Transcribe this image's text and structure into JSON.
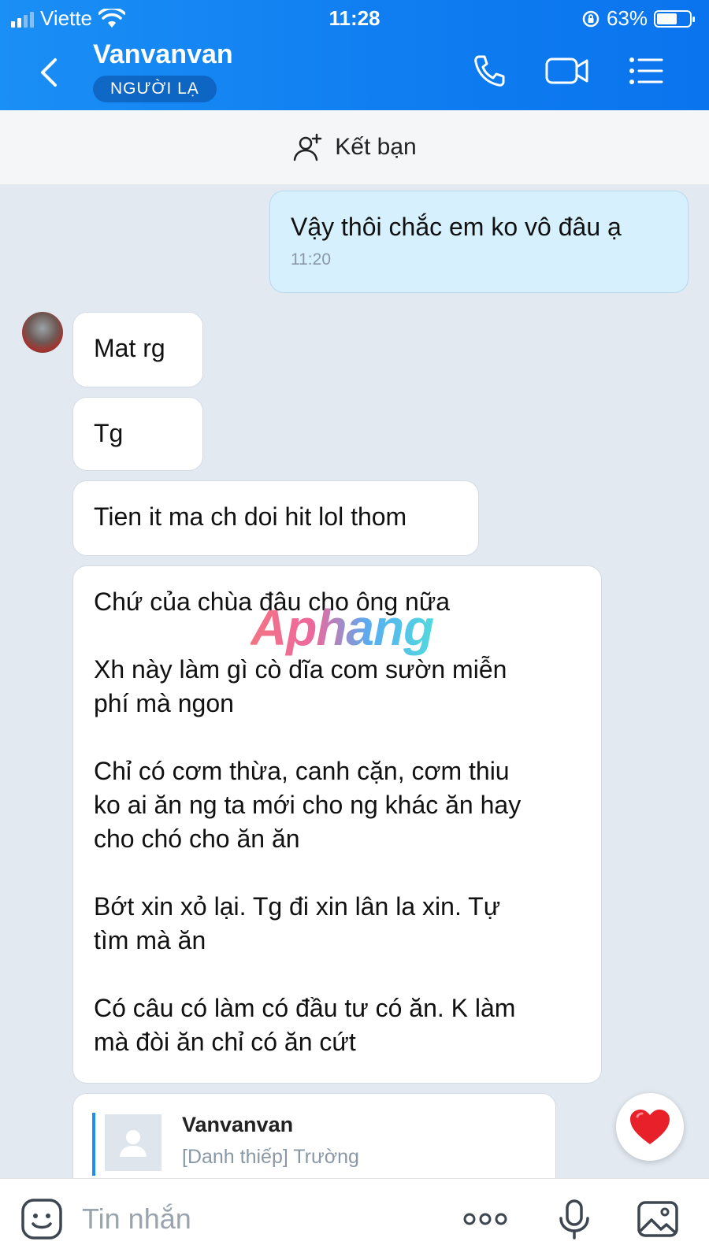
{
  "status_bar": {
    "carrier": "Viette",
    "time": "11:28",
    "battery": "63%",
    "battery_level": 0.63
  },
  "header": {
    "title": "Vanvanvan",
    "badge": "NGƯỜI LẠ"
  },
  "add_friend": {
    "label": "Kết bạn"
  },
  "messages": [
    {
      "from": "me",
      "lines": [
        "Vậy thôi chắc em ko vô đâu ạ"
      ],
      "time": "11:20"
    },
    {
      "from": "other",
      "lines": [
        "Mat rg"
      ]
    },
    {
      "from": "other",
      "lines": [
        "Tg"
      ]
    },
    {
      "from": "other",
      "lines": [
        "Tien it ma ch doi hit lol thom"
      ]
    },
    {
      "from": "other",
      "lines": [
        "Chứ của chùa đâu cho ông nữa",
        "",
        "Xh này làm gì cò dĩa com sườn miễn",
        "phí mà ngon",
        "",
        "Chỉ có cơm thừa, canh cặn, cơm thiu",
        "ko ai ăn ng ta mới cho ng khác ăn hay",
        "cho chó cho ăn ăn",
        "",
        "Bớt xin xỏ lại. Tg đi xin lân la xin. Tự",
        "tìm mà ăn",
        "",
        "Có câu có làm có đầu tư có ăn. K làm",
        "mà đòi ăn chỉ có ăn cứt"
      ]
    }
  ],
  "watermark": "Aphang",
  "contact_card": {
    "name": "Vanvanvan",
    "subtitle": "[Danh thiếp] Trường"
  },
  "input": {
    "placeholder": "Tin nhắn"
  },
  "colors": {
    "header_blue": "#0f7cf0",
    "my_bubble": "#d6f0fd",
    "chat_bg": "#e2e9f1"
  }
}
